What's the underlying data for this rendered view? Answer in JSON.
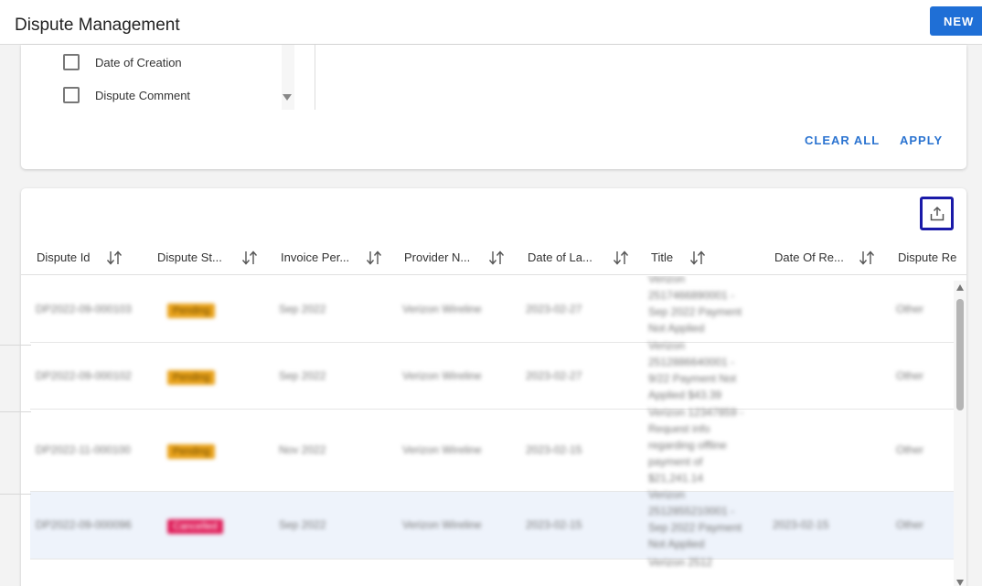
{
  "header": {
    "title": "Dispute Management",
    "new_button": "NEW"
  },
  "filters": {
    "items": [
      {
        "label": "Date of Creation",
        "checked": false
      },
      {
        "label": "Dispute Comment",
        "checked": false
      }
    ],
    "clear_all": "CLEAR ALL",
    "apply": "APPLY"
  },
  "table": {
    "export_icon": "upload-export-icon",
    "columns": [
      "Dispute Id",
      "Dispute St...",
      "Invoice Per...",
      "Provider N...",
      "Date of La...",
      "Title",
      "Date Of Re...",
      "Dispute Re"
    ],
    "rows": [
      {
        "id": "DP2022-09-000103",
        "status": "Pending",
        "status_type": "pending",
        "invoice_period": "Sep 2022",
        "provider": "Verizon Wireline",
        "date_last": "2023-02-27",
        "title": "Verizon 2517466890001 - Sep 2022 Payment Not Applied",
        "date_resolved": "",
        "reason": "Other"
      },
      {
        "id": "DP2022-09-000102",
        "status": "Pending",
        "status_type": "pending",
        "invoice_period": "Sep 2022",
        "provider": "Verizon Wireline",
        "date_last": "2023-02-27",
        "title": "Verizon 2512886640001 - 9/22 Payment Not Applied $43.39",
        "date_resolved": "",
        "reason": "Other"
      },
      {
        "id": "DP2022-11-000100",
        "status": "Pending",
        "status_type": "pending",
        "invoice_period": "Nov 2022",
        "provider": "Verizon Wireline",
        "date_last": "2023-02-15",
        "title": "Verizon 12347859 - Request info regarding offline payment of $21,241.14",
        "date_resolved": "",
        "reason": "Other"
      },
      {
        "id": "DP2022-09-000096",
        "status": "Cancelled",
        "status_type": "cancelled",
        "invoice_period": "Sep 2022",
        "provider": "Verizon Wireline",
        "date_last": "2023-02-15",
        "title": "Verizon 2512855210001 - Sep 2022 Payment Not Applied",
        "date_resolved": "2023-02-15",
        "reason": "Other"
      },
      {
        "id": "",
        "status": "",
        "status_type": "",
        "invoice_period": "",
        "provider": "",
        "date_last": "",
        "title": "Verizon 2512",
        "date_resolved": "",
        "reason": ""
      }
    ]
  }
}
